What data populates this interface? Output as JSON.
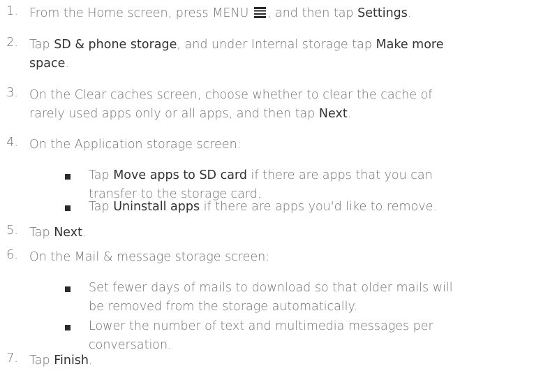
{
  "steps": [
    {
      "number": "1.",
      "parts": [
        "From the Home screen, press MENU ",
        "",
        ", and then tap ",
        "Settings",
        "."
      ]
    },
    {
      "number": "2.",
      "line1": [
        "Tap ",
        "SD & phone storage",
        ", and under Internal storage tap ",
        "Make more"
      ],
      "line2": [
        "space",
        "."
      ]
    },
    {
      "number": "3.",
      "line1": "On the Clear caches screen, choose whether to clear the cache of",
      "line2": [
        "rarely used apps only or all apps, and then tap ",
        "Next",
        "."
      ]
    },
    {
      "number": "4.",
      "text": "On the Application storage screen:",
      "bullets": [
        {
          "line1": [
            "Tap ",
            "Move apps to SD card",
            " if there are apps that you can"
          ],
          "line2": "transfer to the storage card."
        },
        {
          "line1": [
            "Tap ",
            "Uninstall apps",
            " if there are apps you'd like to remove."
          ]
        }
      ]
    },
    {
      "number": "5.",
      "parts": [
        "Tap ",
        "Next",
        "."
      ]
    },
    {
      "number": "6.",
      "text": "On the Mail & message storage screen:",
      "bullets": [
        {
          "line1": "Set fewer days of mails to download so that older mails will",
          "line2": "be removed from the storage automatically."
        },
        {
          "line1": "Lower the number of text and multimedia messages per",
          "line2": "conversation."
        }
      ]
    },
    {
      "number": "7.",
      "parts": [
        "Tap ",
        "Finish",
        "."
      ]
    }
  ],
  "icons": {
    "menu": "menu-icon"
  },
  "colors": {
    "body_text": "#707070",
    "emphasis_text": "#333333",
    "bullet": "#2a2a2a"
  }
}
